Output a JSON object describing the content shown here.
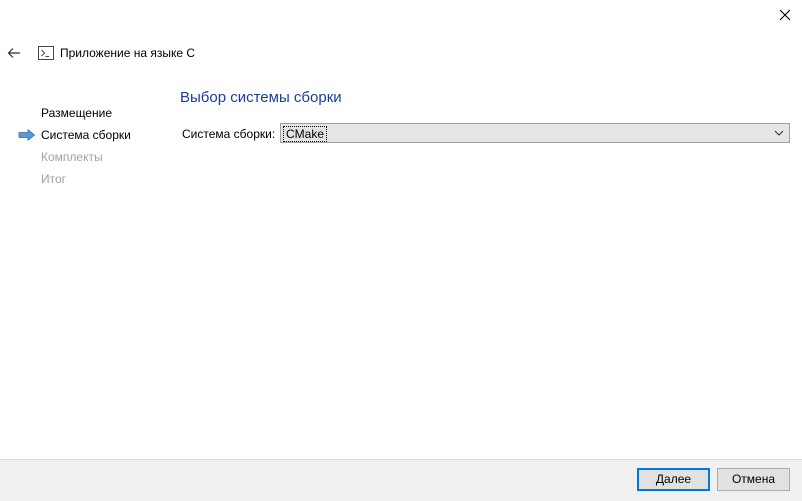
{
  "window": {
    "title": "Приложение на языке C"
  },
  "icons": {
    "close": "close-icon",
    "back": "back-arrow-icon",
    "app": "console-app-icon",
    "current_step": "right-arrow-icon",
    "dropdown": "chevron-down-icon"
  },
  "steps": [
    {
      "label": "Размещение",
      "state": "done"
    },
    {
      "label": "Система сборки",
      "state": "current"
    },
    {
      "label": "Комплекты",
      "state": "pending"
    },
    {
      "label": "Итог",
      "state": "pending"
    }
  ],
  "page": {
    "heading": "Выбор системы сборки",
    "build_system_label": "Система сборки:",
    "build_system_value": "CMake"
  },
  "footer": {
    "next_label_accel": "Д",
    "next_label_rest": "алее",
    "cancel_label": "Отмена"
  },
  "colors": {
    "heading": "#1c3f94",
    "pending_step": "#a0a0a0",
    "arrow": "#5b9bd5",
    "primary_border": "#0078d7"
  }
}
